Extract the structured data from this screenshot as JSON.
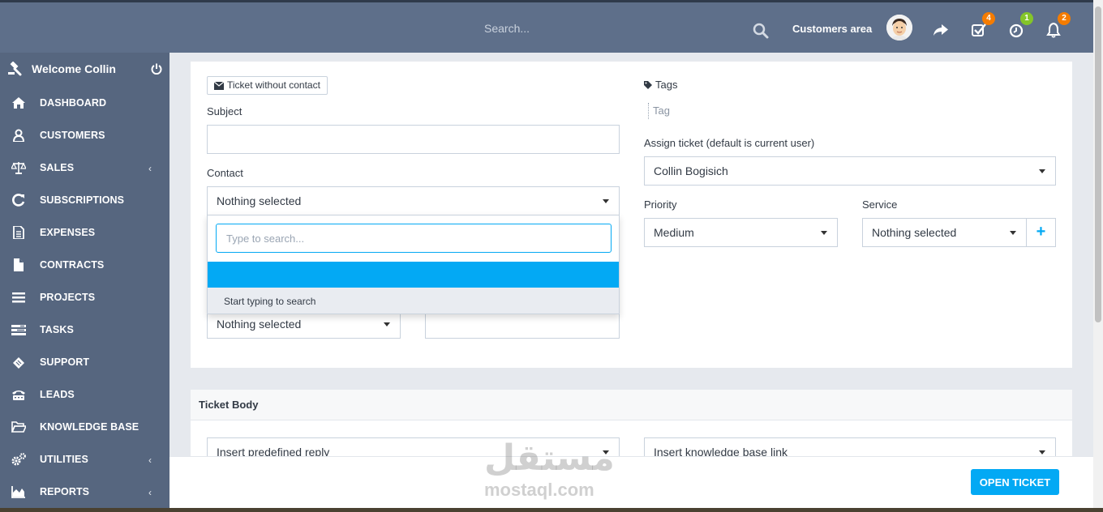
{
  "header": {
    "search_placeholder": "Search...",
    "customers_area": "Customers area",
    "badges": {
      "tasks": "4",
      "timers": "1",
      "notifications": "2"
    },
    "colors": {
      "bar": "#5e6f8a",
      "badge_orange": "#f57c00",
      "badge_green": "#84c529"
    }
  },
  "sidebar": {
    "welcome": "Welcome Collin",
    "items": [
      {
        "label": "DASHBOARD",
        "icon": "home-icon"
      },
      {
        "label": "CUSTOMERS",
        "icon": "user-icon"
      },
      {
        "label": "SALES",
        "icon": "balance-scale-icon",
        "chevron": "‹"
      },
      {
        "label": "SUBSCRIPTIONS",
        "icon": "refresh-icon"
      },
      {
        "label": "EXPENSES",
        "icon": "file-text-icon"
      },
      {
        "label": "CONTRACTS",
        "icon": "file-icon"
      },
      {
        "label": "PROJECTS",
        "icon": "bars-icon"
      },
      {
        "label": "TASKS",
        "icon": "tasks-icon"
      },
      {
        "label": "SUPPORT",
        "icon": "ticket-icon"
      },
      {
        "label": "LEADS",
        "icon": "tty-icon"
      },
      {
        "label": "KNOWLEDGE BASE",
        "icon": "folder-open-icon"
      },
      {
        "label": "UTILITIES",
        "icon": "cogs-icon",
        "chevron": "‹"
      },
      {
        "label": "REPORTS",
        "icon": "area-chart-icon",
        "chevron": "‹"
      }
    ]
  },
  "form": {
    "ticket_without_contact": "Ticket without contact",
    "subject_label": "Subject",
    "subject_value": "",
    "contact_label": "Contact",
    "contact_value": "Nothing selected",
    "dropdown_search_placeholder": "Type to search...",
    "dropdown_hint": "Start typing to search",
    "lower_select_value": "Nothing selected",
    "lower_input_value": "",
    "tags_label": "Tags",
    "tag_placeholder": "Tag",
    "assign_label": "Assign ticket (default is current user)",
    "assign_value": "Collin Bogisich",
    "priority_label": "Priority",
    "priority_value": "Medium",
    "service_label": "Service",
    "service_value": "Nothing selected",
    "add_service": "+"
  },
  "body_panel": {
    "title": "Ticket Body",
    "predefined_reply": "Insert predefined reply",
    "kb_link": "Insert knowledge base link"
  },
  "footer": {
    "open_ticket": "OPEN TICKET"
  },
  "watermark": {
    "arabic": "مستقل",
    "latin": "mostaql.com"
  }
}
